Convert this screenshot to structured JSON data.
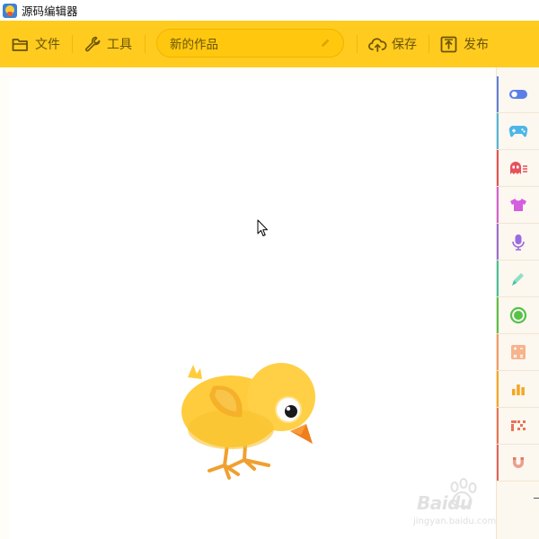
{
  "window": {
    "title": "源码编辑器",
    "app_icon": "source-code-editor-app-icon"
  },
  "toolbar": {
    "file_label": "文件",
    "tools_label": "工具",
    "project_title": "新的作品",
    "save_label": "保存",
    "publish_label": "发布",
    "icons": [
      "folder-icon",
      "wrench-icon",
      "pencil-icon",
      "cloud-upload-icon",
      "upload-box-icon"
    ]
  },
  "categories": [
    {
      "icon": "toggle-icon",
      "color": "#5b7fe6"
    },
    {
      "icon": "gamepad-icon",
      "color": "#4cb6e8"
    },
    {
      "icon": "ghost-icon",
      "color": "#e6515b"
    },
    {
      "icon": "tshirt-icon",
      "color": "#d45ee0"
    },
    {
      "icon": "microphone-icon",
      "color": "#9a6be0"
    },
    {
      "icon": "pen-icon",
      "color": "#3ec4a2"
    },
    {
      "icon": "circle-target-icon",
      "color": "#56c24a"
    },
    {
      "icon": "calculator-icon",
      "color": "#f29b6b"
    },
    {
      "icon": "bar-chart-icon",
      "color": "#f5a623"
    },
    {
      "icon": "pixel-icon",
      "color": "#e9735a"
    },
    {
      "icon": "magnet-icon",
      "color": "#dd6363"
    }
  ],
  "colors": {
    "toolbar": "#ffcb1f",
    "toolbar_text": "#6b5405",
    "stage": "#ffffff"
  },
  "watermark": {
    "brand": "Baidu",
    "sub": "jingyan.baidu.com"
  }
}
